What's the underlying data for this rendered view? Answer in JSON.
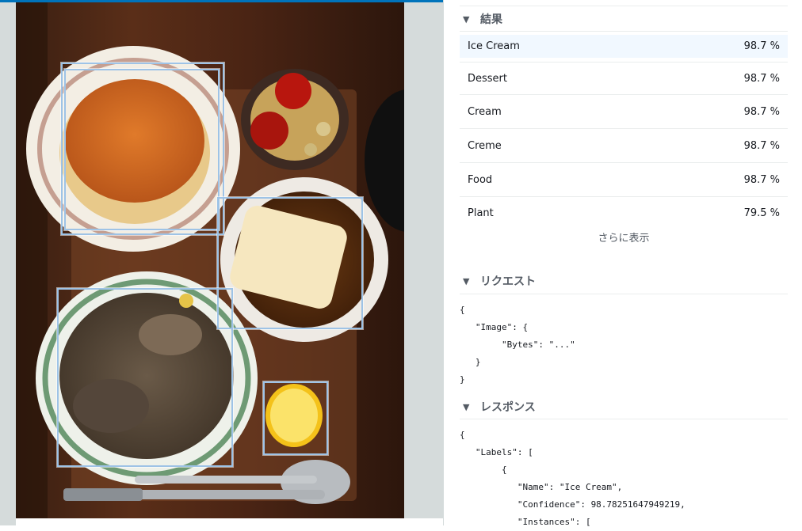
{
  "detected_labels": {
    "bounding_box_count": 5
  },
  "results_section": {
    "title": "結果",
    "items": [
      {
        "name": "Ice Cream",
        "confidence": "98.7 %"
      },
      {
        "name": "Dessert",
        "confidence": "98.7 %"
      },
      {
        "name": "Cream",
        "confidence": "98.7 %"
      },
      {
        "name": "Creme",
        "confidence": "98.7 %"
      },
      {
        "name": "Food",
        "confidence": "98.7 %"
      },
      {
        "name": "Plant",
        "confidence": "79.5 %"
      }
    ],
    "show_more_label": "さらに表示"
  },
  "request_section": {
    "title": "リクエスト",
    "code": "{\n   \"Image\": {\n        \"Bytes\": \"...\"\n   }\n}"
  },
  "response_section": {
    "title": "レスポンス",
    "code": "{\n   \"Labels\": [\n        {\n           \"Name\": \"Ice Cream\",\n           \"Confidence\": 98.78251647949219,\n           \"Instances\": ["
  },
  "colors": {
    "accent": "#0073bb",
    "bounding_box": "#9ec3e6",
    "selected_row": "#f1f8ff"
  },
  "icons": {
    "section_toggle": "caret-down-icon"
  }
}
